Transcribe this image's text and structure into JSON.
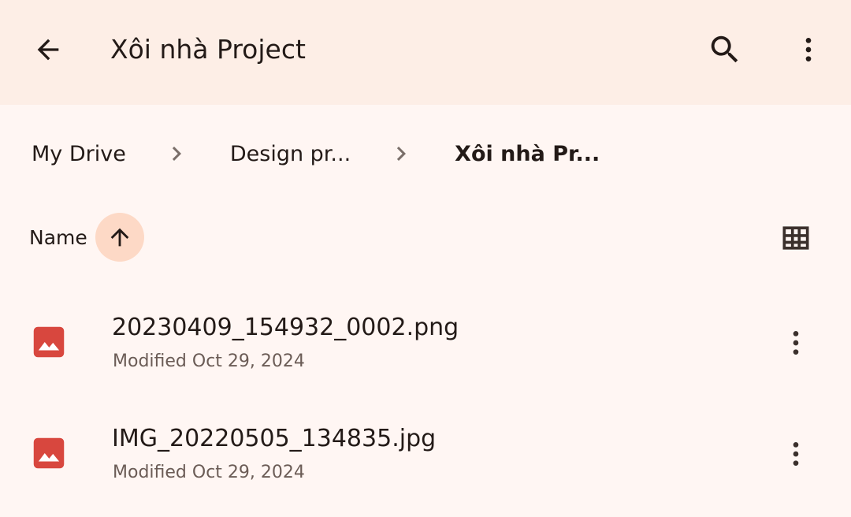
{
  "header": {
    "title": "Xôi nhà Project",
    "back_icon": "arrow-back-icon",
    "search_icon": "search-icon",
    "more_icon": "more-vert-icon"
  },
  "breadcrumb": {
    "items": [
      "My Drive",
      "Design pr...",
      "Xôi nhà Pr..."
    ],
    "separator_icon": "chevron-right-icon"
  },
  "sort": {
    "label": "Name",
    "direction_icon": "arrow-upward-icon",
    "view_toggle_icon": "grid-view-icon"
  },
  "files": [
    {
      "name": "20230409_154932_0002.png",
      "modified_label": "Modified",
      "modified_date": "Oct 29, 2024",
      "icon": "image-file-icon"
    },
    {
      "name": "IMG_20220505_134835.jpg",
      "modified_label": "Modified",
      "modified_date": "Oct 29, 2024",
      "icon": "image-file-icon"
    }
  ],
  "colors": {
    "appbar_bg": "#fdeee6",
    "page_bg": "#fff6f3",
    "accent_sort_bg": "#fdd9c6",
    "image_icon": "#d8473e"
  }
}
